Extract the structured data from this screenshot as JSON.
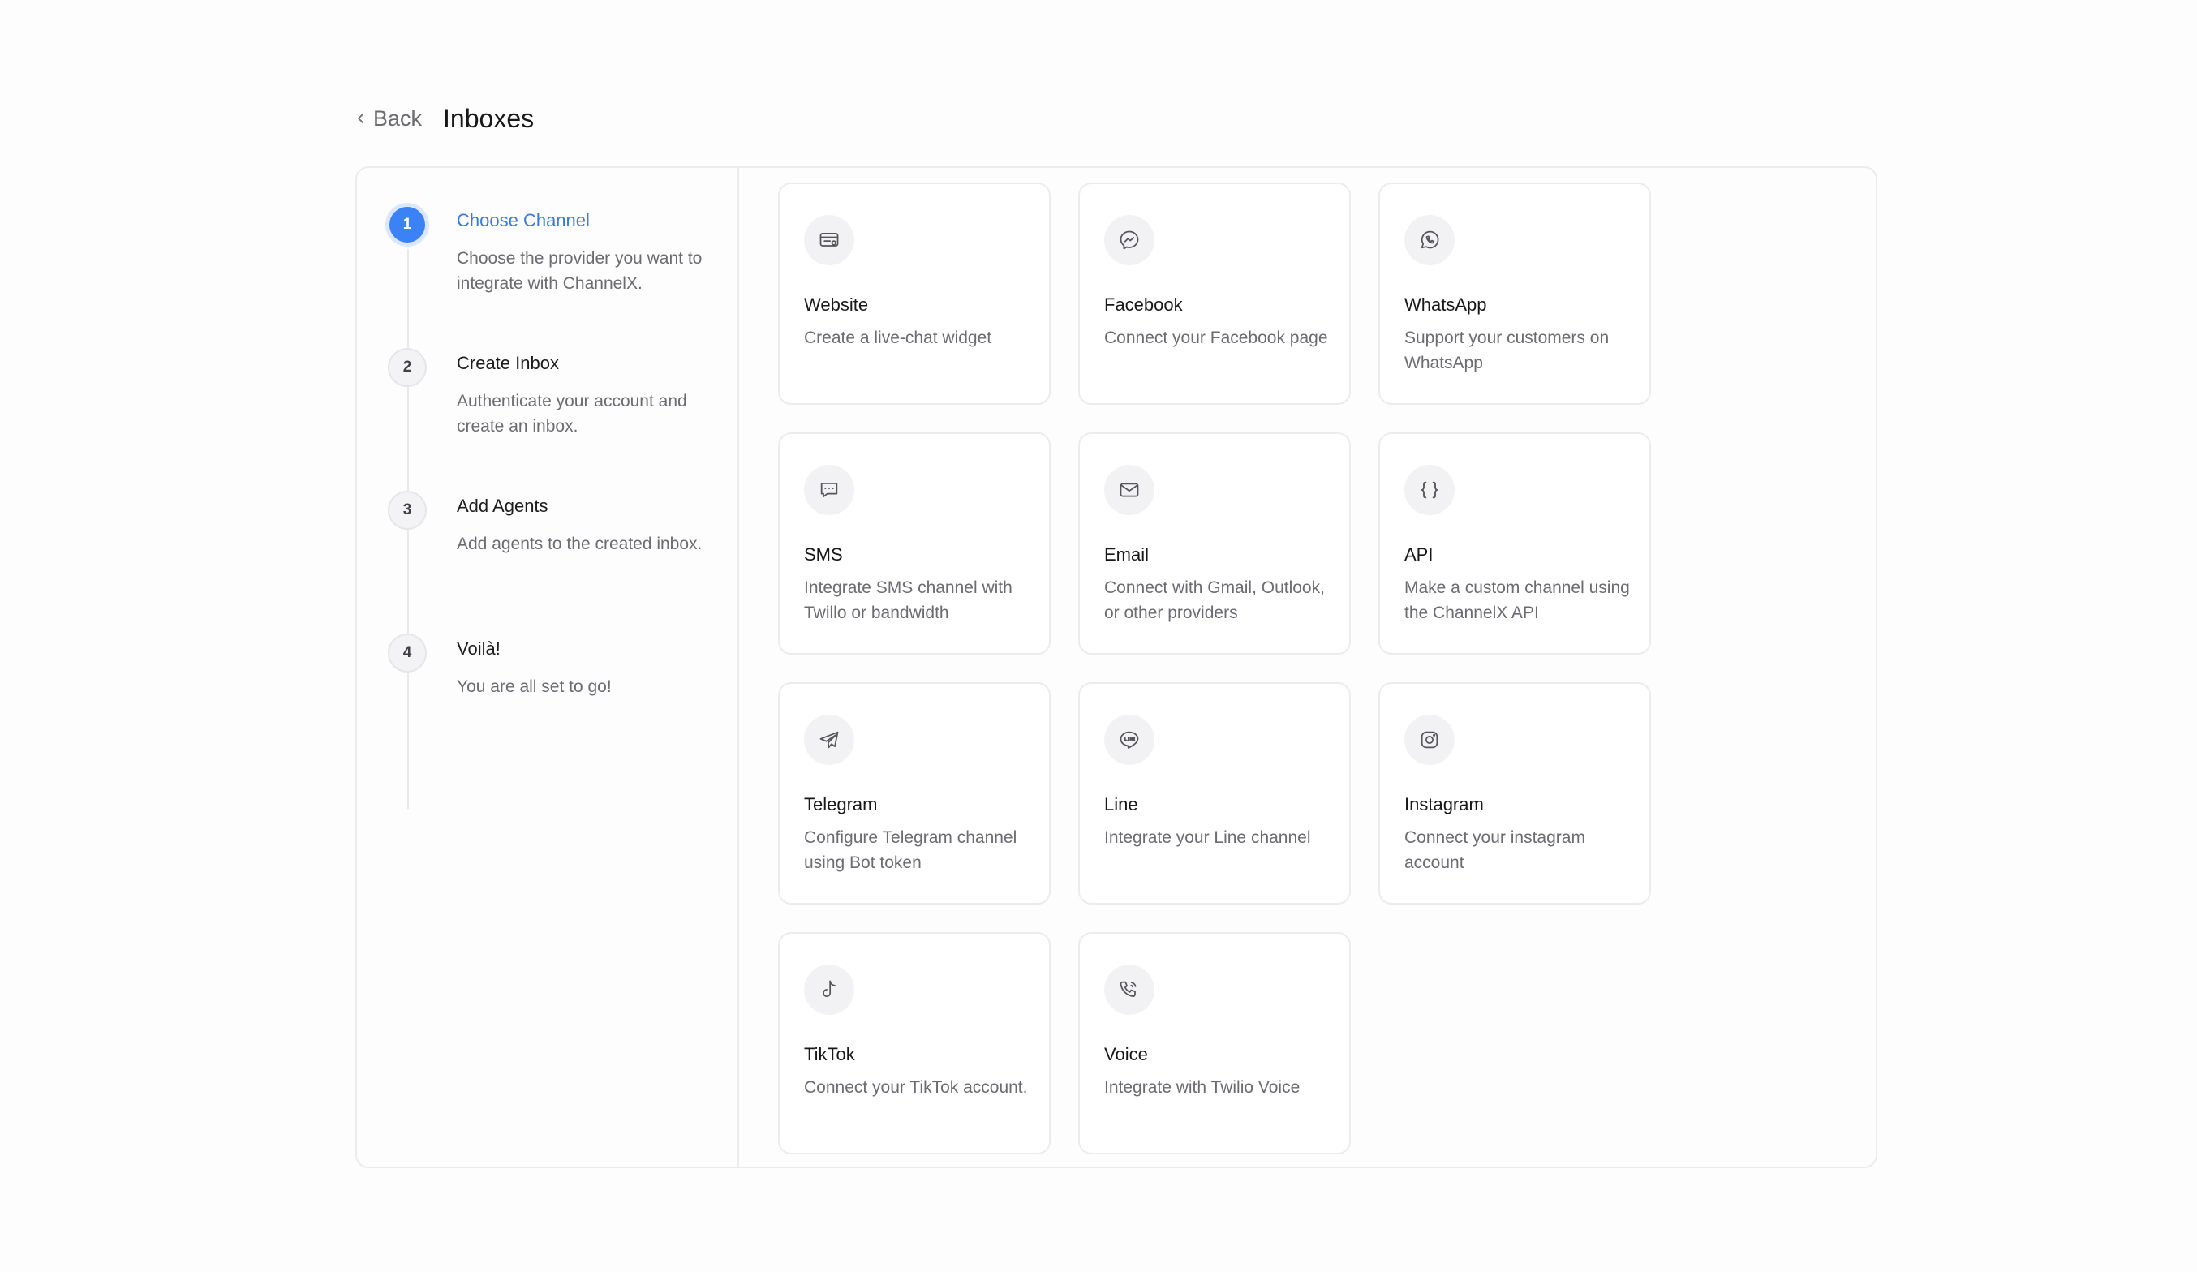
{
  "header": {
    "back_label": "Back",
    "title": "Inboxes"
  },
  "steps": [
    {
      "number": "1",
      "title": "Choose Channel",
      "description": "Choose the provider you want to integrate with ChannelX.",
      "active": true
    },
    {
      "number": "2",
      "title": "Create Inbox",
      "description": "Authenticate your account and create an inbox.",
      "active": false
    },
    {
      "number": "3",
      "title": "Add Agents",
      "description": "Add agents to the created inbox.",
      "active": false
    },
    {
      "number": "4",
      "title": "Voilà!",
      "description": "You are all set to go!",
      "active": false
    }
  ],
  "channels": [
    {
      "icon": "website-icon",
      "title": "Website",
      "description": "Create a live-chat widget"
    },
    {
      "icon": "facebook-icon",
      "title": "Facebook",
      "description": "Connect your Facebook page"
    },
    {
      "icon": "whatsapp-icon",
      "title": "WhatsApp",
      "description": "Support your customers on WhatsApp"
    },
    {
      "icon": "sms-icon",
      "title": "SMS",
      "description": "Integrate SMS channel with Twillo or bandwidth"
    },
    {
      "icon": "email-icon",
      "title": "Email",
      "description": "Connect with Gmail, Outlook, or other providers"
    },
    {
      "icon": "api-icon",
      "title": "API",
      "description": "Make a custom channel using the ChannelX API"
    },
    {
      "icon": "telegram-icon",
      "title": "Telegram",
      "description": "Configure Telegram channel using Bot token"
    },
    {
      "icon": "line-icon",
      "title": "Line",
      "description": "Integrate your Line channel"
    },
    {
      "icon": "instagram-icon",
      "title": "Instagram",
      "description": "Connect your instagram account"
    },
    {
      "icon": "tiktok-icon",
      "title": "TikTok",
      "description": "Connect your TikTok account."
    },
    {
      "icon": "voice-icon",
      "title": "Voice",
      "description": "Integrate with Twilio Voice"
    }
  ],
  "colors": {
    "accent": "#3b82f6",
    "accent_text": "#3a7bd5",
    "border": "#ececef",
    "muted_text": "#6b6b72"
  }
}
